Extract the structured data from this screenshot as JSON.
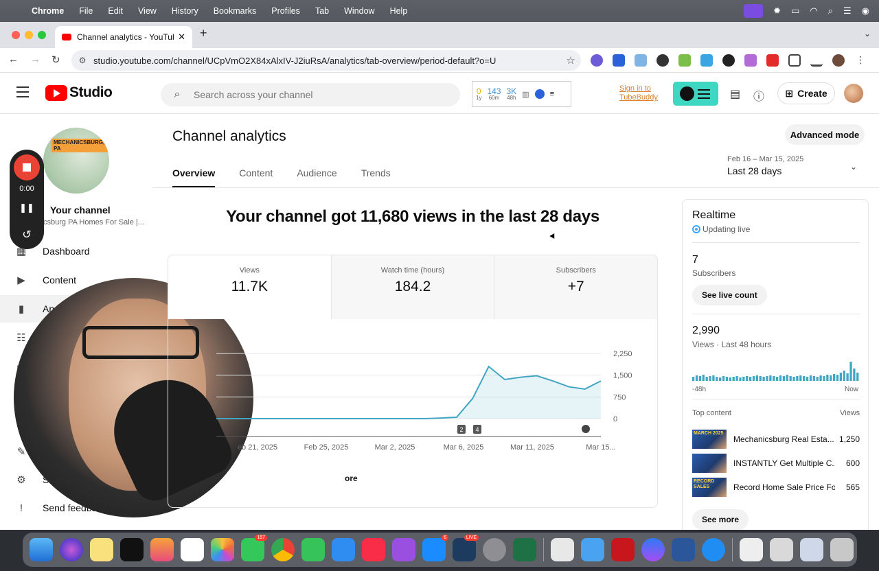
{
  "menubar": {
    "app": "Chrome",
    "items": [
      "File",
      "Edit",
      "View",
      "History",
      "Bookmarks",
      "Profiles",
      "Tab",
      "Window",
      "Help"
    ]
  },
  "browser": {
    "tab_title": "Channel analytics - YouTube S",
    "url": "studio.youtube.com/channel/UCpVmO2X84xAlxIV-J2iuRsA/analytics/tab-overview/period-default?o=U"
  },
  "header": {
    "logo_text": "Studio",
    "search_placeholder": "Search across your channel",
    "tb_stats": [
      {
        "value": "0",
        "sub": "1y"
      },
      {
        "value": "143",
        "sub": "60m"
      },
      {
        "value": "3K",
        "sub": "48h"
      }
    ],
    "signin_line1": "Sign in to",
    "signin_line2": "TubeBuddy",
    "create_label": "Create"
  },
  "sidebar": {
    "channel_tag": "MECHANICSBURG, PA",
    "your_channel": "Your channel",
    "channel_name": "csburg PA Homes For Sale |...",
    "items": [
      {
        "label": "Dashboard",
        "icon": "dashboard-icon"
      },
      {
        "label": "Content",
        "icon": "content-icon"
      },
      {
        "label": "An",
        "icon": "analytics-icon"
      },
      {
        "label": "",
        "icon": "community-icon"
      },
      {
        "label": "",
        "icon": "subtitles-icon"
      },
      {
        "label": "",
        "icon": "customization-icon"
      },
      {
        "label": "S",
        "icon": "settings-icon"
      },
      {
        "label": "Send feedba",
        "icon": "feedback-icon"
      }
    ]
  },
  "recorder": {
    "time": "0:00"
  },
  "main": {
    "title": "Channel analytics",
    "advanced_mode": "Advanced mode",
    "tabs": [
      "Overview",
      "Content",
      "Audience",
      "Trends"
    ],
    "period_range": "Feb 16 – Mar 15, 2025",
    "period_label": "Last 28 days",
    "headline": "Your channel got 11,680 views in the last 28 days",
    "metrics": [
      {
        "label": "Views",
        "value": "11.7K"
      },
      {
        "label": "Watch time (hours)",
        "value": "184.2"
      },
      {
        "label": "Subscribers",
        "value": "+7"
      }
    ],
    "see_more": "ore"
  },
  "chart_data": {
    "type": "area",
    "x_tick_labels": [
      "eb 21, 2025",
      "Feb 25, 2025",
      "Mar 2, 2025",
      "Mar 6, 2025",
      "Mar 11, 2025",
      "Mar 15..."
    ],
    "y_tick_labels": [
      "2,250",
      "1,500",
      "750",
      "0"
    ],
    "ylim": [
      0,
      2250
    ],
    "series": [
      {
        "values": [
          0,
          0,
          0,
          0,
          0,
          0,
          0,
          0,
          0,
          0,
          0,
          0,
          0,
          0,
          20,
          50,
          700,
          1800,
          1350,
          1430,
          1480,
          1300,
          1100,
          1020,
          1300
        ]
      }
    ],
    "markers": [
      "2",
      "4"
    ],
    "color": "#41a5c4"
  },
  "realtime": {
    "title": "Realtime",
    "live": "Updating live",
    "subscribers_value": "7",
    "subscribers_label": "Subscribers",
    "see_live_count": "See live count",
    "views_value": "2,990",
    "views_label": "Views · Last 48 hours",
    "axis_start": "-48h",
    "axis_end": "Now",
    "top_content": "Top content",
    "views_col": "Views",
    "bars": [
      6,
      8,
      7,
      9,
      6,
      7,
      8,
      6,
      5,
      7,
      6,
      5,
      6,
      7,
      5,
      6,
      7,
      6,
      7,
      8,
      7,
      6,
      7,
      8,
      7,
      6,
      8,
      7,
      9,
      7,
      6,
      7,
      8,
      7,
      6,
      8,
      7,
      6,
      8,
      7,
      9,
      8,
      10,
      9,
      12,
      15,
      11,
      28,
      18,
      12
    ],
    "items": [
      {
        "title": "Mechanicsburg Real Esta...",
        "views": "1,250",
        "thumb_text": "MARCH 2025"
      },
      {
        "title": "INSTANTLY Get Multiple C...",
        "views": "600",
        "thumb_text": ""
      },
      {
        "title": "Record Home Sale Price Fo...",
        "views": "565",
        "thumb_text": "RECORD SALES"
      }
    ],
    "see_more": "See more"
  },
  "dock": {
    "badges": {
      "messages": "157",
      "appstore": "6",
      "live": "LIVE"
    }
  }
}
